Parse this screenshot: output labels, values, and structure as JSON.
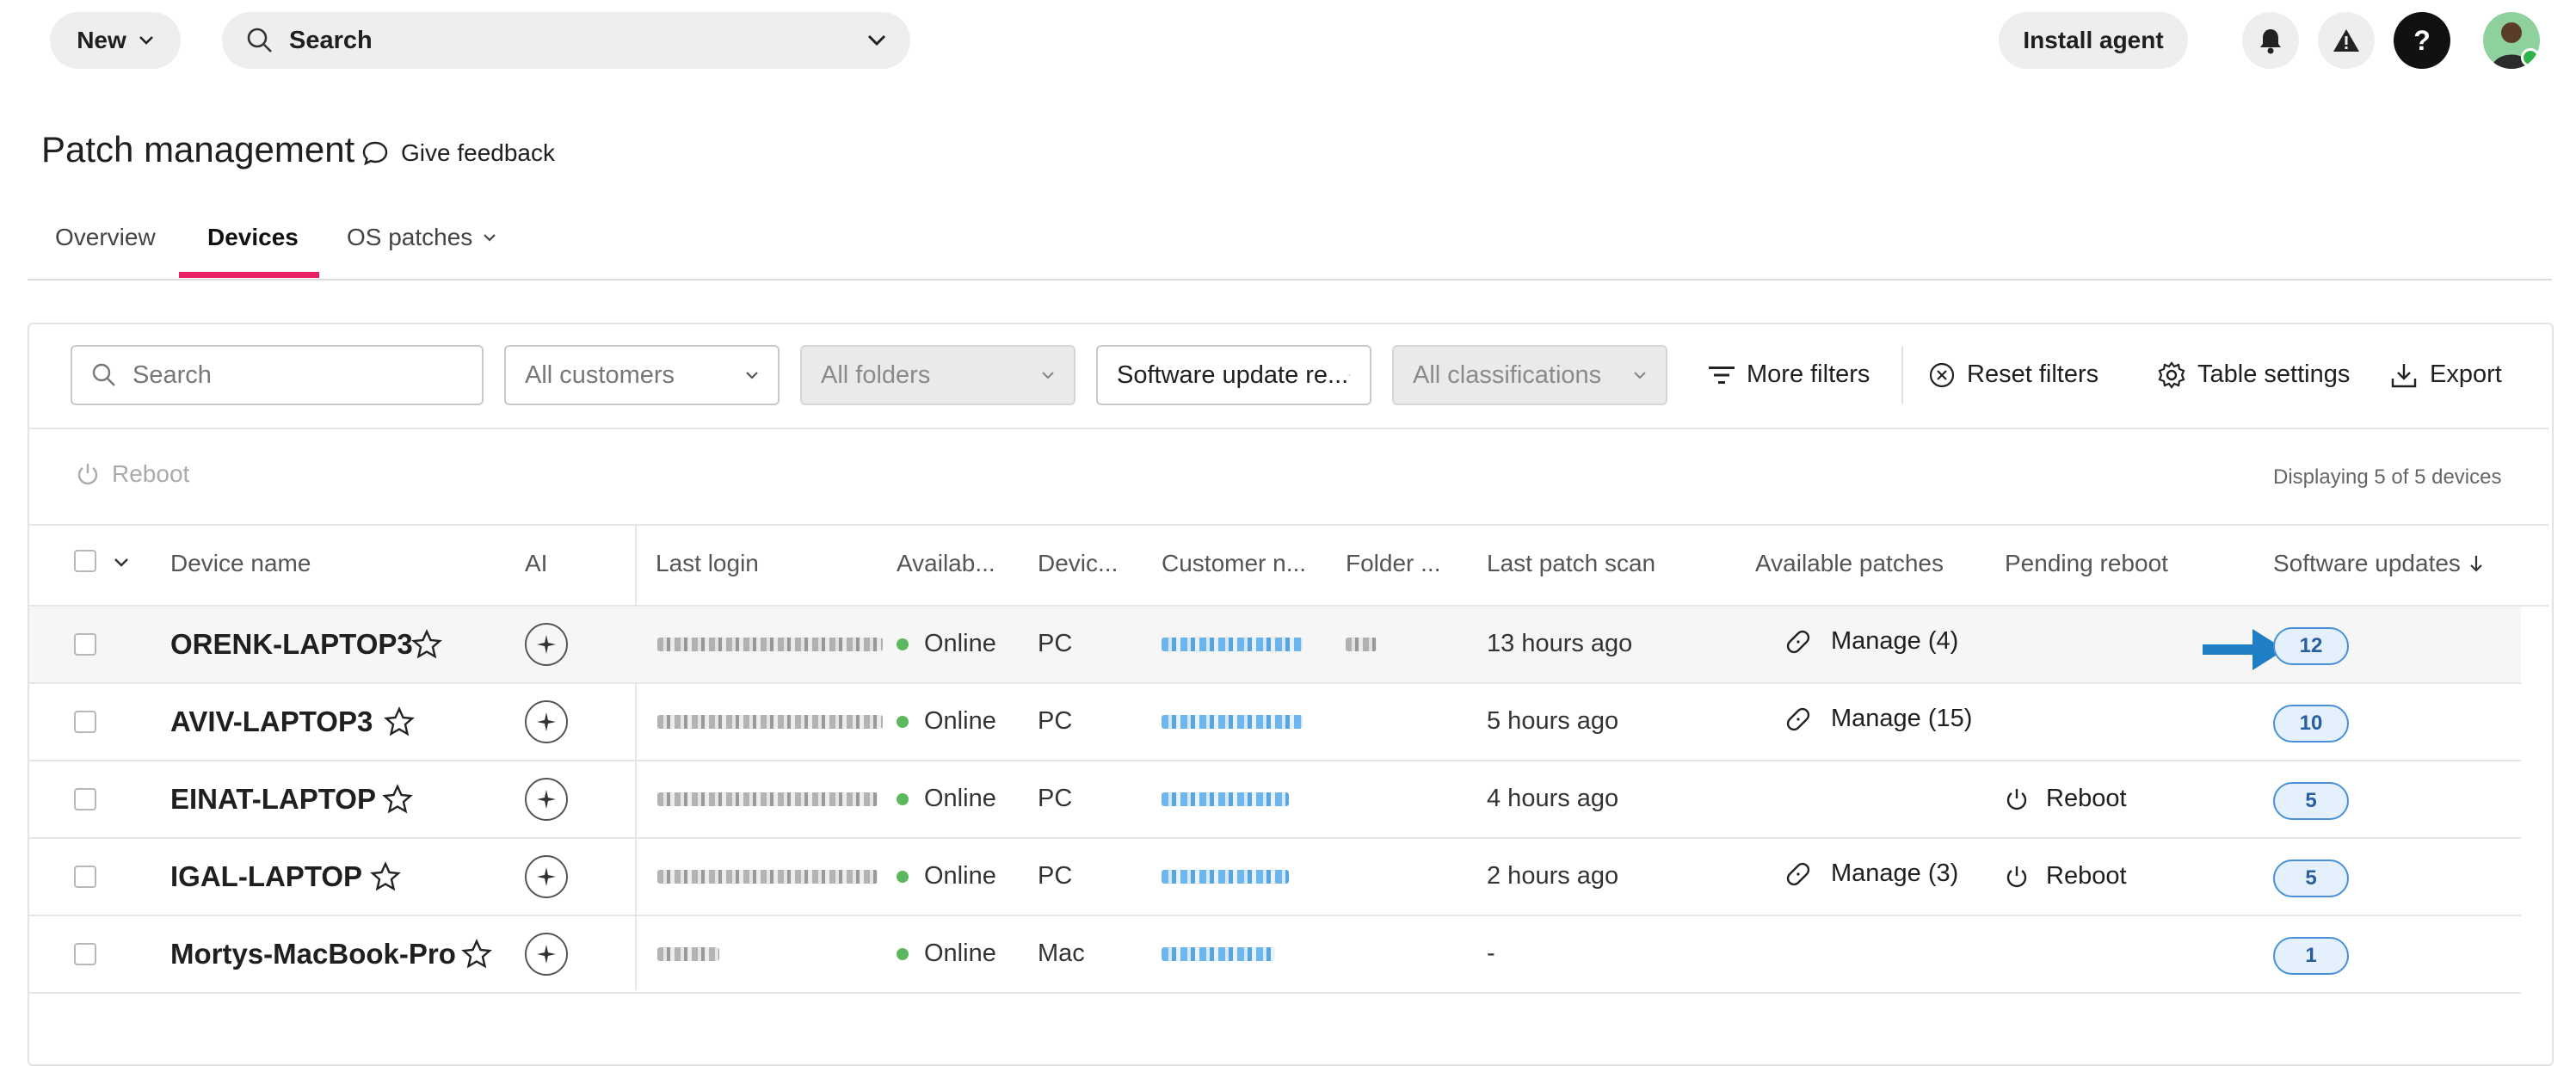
{
  "topbar": {
    "new_label": "New",
    "search_label": "Search",
    "install_label": "Install agent",
    "help_label": "?"
  },
  "header": {
    "title": "Patch management",
    "feedback_label": "Give feedback"
  },
  "tabs": [
    {
      "label": "Overview"
    },
    {
      "label": "Devices"
    },
    {
      "label": "OS patches"
    }
  ],
  "filters": {
    "search_placeholder": "Search",
    "customers": "All customers",
    "folders": "All folders",
    "software": "Software update re...",
    "classifications": "All classifications",
    "more_filters": "More filters",
    "reset_filters": "Reset filters",
    "table_settings": "Table settings",
    "export": "Export"
  },
  "actions": {
    "reboot": "Reboot",
    "displaying": "Displaying 5 of 5 devices"
  },
  "columns": {
    "device_name": "Device name",
    "ai": "AI",
    "last_login": "Last login",
    "availability": "Availab...",
    "device_type": "Devic...",
    "customer": "Customer n...",
    "folder": "Folder ...",
    "last_scan": "Last patch scan",
    "patches": "Available patches",
    "pending": "Pending reboot",
    "software": "Software updates"
  },
  "rows": [
    {
      "name": "ORENK-LAPTOP3",
      "status": "Online",
      "type": "PC",
      "scan": "13 hours ago",
      "patches": "Manage (4)",
      "pending": "",
      "updates": "12"
    },
    {
      "name": "AVIV-LAPTOP3",
      "status": "Online",
      "type": "PC",
      "scan": "5 hours ago",
      "patches": "Manage (15)",
      "pending": "",
      "updates": "10"
    },
    {
      "name": "EINAT-LAPTOP",
      "status": "Online",
      "type": "PC",
      "scan": "4 hours ago",
      "patches": "",
      "pending": "Reboot",
      "updates": "5"
    },
    {
      "name": "IGAL-LAPTOP",
      "status": "Online",
      "type": "PC",
      "scan": "2 hours ago",
      "patches": "Manage (3)",
      "pending": "Reboot",
      "updates": "5"
    },
    {
      "name": "Mortys-MacBook-Pro",
      "status": "Online",
      "type": "Mac",
      "scan": "-",
      "patches": "",
      "pending": "",
      "updates": "1"
    }
  ],
  "colors": {
    "accent": "#e8205f",
    "arrow": "#1f7fc4",
    "badge_border": "#4a90d9"
  }
}
